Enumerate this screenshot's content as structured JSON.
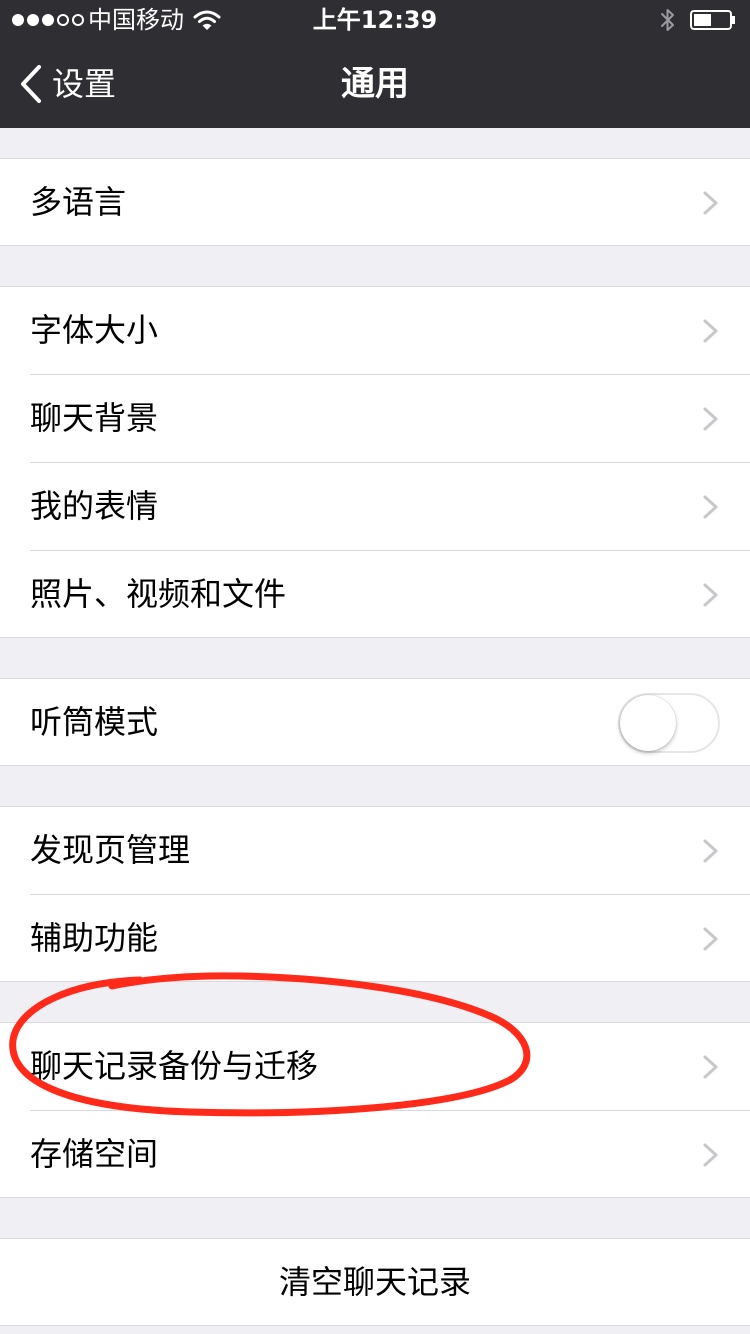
{
  "status_bar": {
    "carrier": "中国移动",
    "time": "上午12:39",
    "signal_bars_filled": 3,
    "signal_bars_total": 5,
    "icons": [
      "signal-dots-icon",
      "wifi-icon",
      "bluetooth-icon",
      "battery-icon"
    ]
  },
  "nav": {
    "back_label": "设置",
    "title": "通用",
    "back_icon": "chevron-left-icon"
  },
  "groups": [
    {
      "items": [
        {
          "label": "多语言",
          "accessory": "chevron"
        }
      ]
    },
    {
      "items": [
        {
          "label": "字体大小",
          "accessory": "chevron"
        },
        {
          "label": "聊天背景",
          "accessory": "chevron"
        },
        {
          "label": "我的表情",
          "accessory": "chevron"
        },
        {
          "label": "照片、视频和文件",
          "accessory": "chevron"
        }
      ]
    },
    {
      "items": [
        {
          "label": "听筒模式",
          "accessory": "toggle",
          "toggle_on": false
        }
      ]
    },
    {
      "items": [
        {
          "label": "发现页管理",
          "accessory": "chevron"
        },
        {
          "label": "辅助功能",
          "accessory": "chevron"
        }
      ]
    },
    {
      "items": [
        {
          "label": "聊天记录备份与迁移",
          "accessory": "chevron",
          "annotated": true
        },
        {
          "label": "存储空间",
          "accessory": "chevron"
        }
      ]
    },
    {
      "items": [
        {
          "label": "清空聊天记录",
          "accessory": "none",
          "centered": true
        }
      ]
    }
  ],
  "colors": {
    "nav_background": "#2e2e33",
    "page_background": "#efeff4",
    "chevron": "#c7c7cc",
    "annotation_stroke": "#ff2a1a",
    "separator": "#d9d9de"
  }
}
